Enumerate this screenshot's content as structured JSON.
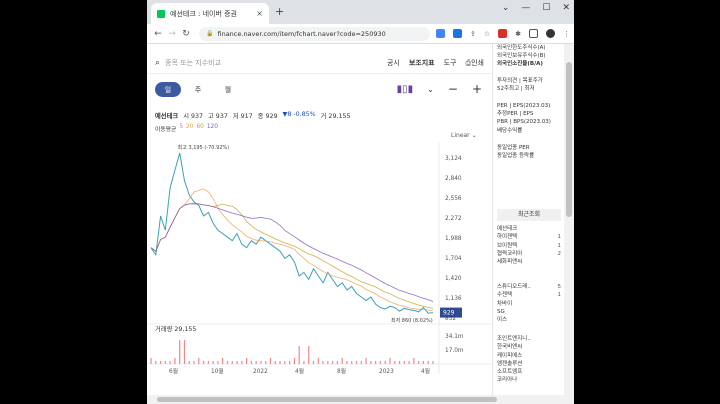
{
  "browser": {
    "tab_title": "예선테크 : 네이버 증권",
    "tab_close": "×",
    "new_tab": "+",
    "window_controls": [
      "⌄",
      "—",
      "☐",
      "✕"
    ],
    "url": "finance.naver.com/item/fchart.naver?code=250930"
  },
  "search": {
    "placeholder": "종목 또는 지수비교"
  },
  "toplinks": [
    "공시",
    "보조지표",
    "도구",
    "인쇄"
  ],
  "periods": [
    "일",
    "주",
    "월"
  ],
  "active_period": 0,
  "quote": {
    "name": "예선테크",
    "open": "시 937",
    "high": "고 937",
    "low": "저 917",
    "close": "종 929",
    "change": "▼8 -0.85%",
    "volume": "거 29,155"
  },
  "ma": {
    "label": "이동평균",
    "items": [
      {
        "v": "5",
        "color": "#e57373"
      },
      {
        "v": "20",
        "color": "#f0a04b"
      },
      {
        "v": "60",
        "color": "#c9a227"
      },
      {
        "v": "120",
        "color": "#7e57c2"
      }
    ]
  },
  "scale": "Linear",
  "volume_label": "거래량 29,155",
  "chart_data": {
    "type": "line",
    "y_ticks": [
      "3,124",
      "2,840",
      "2,556",
      "2,272",
      "1,988",
      "1,704",
      "1,420",
      "1,136",
      "852"
    ],
    "ylim": [
      852,
      3124
    ],
    "x_ticks": [
      "6월",
      "10월",
      "2022",
      "4월",
      "8월",
      "2023",
      "4월"
    ],
    "last_price": "929",
    "high_label": "최고 3,195 (-70.92%)",
    "low_label": "최저 860 (8.02%)",
    "volume_ticks": [
      "34.1m",
      "17.0m"
    ],
    "series": [
      {
        "values": [
          1850,
          1750,
          2300,
          2100,
          2700,
          2950,
          3195,
          2800,
          2600,
          2500,
          2450,
          2300,
          2350,
          2200,
          2100,
          2050,
          2000,
          1950,
          2050,
          1900,
          1850,
          1950,
          1900,
          2000,
          1950,
          1900,
          1850,
          1800,
          1700,
          1750,
          1650,
          1450,
          1500,
          1400,
          1550,
          1450,
          1350,
          1500,
          1400,
          1300,
          1350,
          1250,
          1300,
          1200,
          1150,
          1100,
          1150,
          1050,
          1000,
          980,
          1020,
          1000,
          950,
          990,
          970,
          960,
          940,
          1000,
          920,
          929
        ]
      }
    ]
  },
  "sidepanel": {
    "top_items": [
      "외국인한도주식수(A)",
      "외국인보유주식수(B)",
      "외국인소진율(B/A)"
    ],
    "invest_items": [
      "투자의견 | 목표주가",
      "52주최고 | 최저"
    ],
    "per_items": [
      "PER | EPS(2023.03)",
      "추정PER | EPS",
      "PBR | BPS(2023.03)",
      "배당수익률"
    ],
    "industry_items": [
      "동일업종 PER",
      "동일업종 등락률"
    ],
    "recent_title": "최근조회",
    "recent": [
      {
        "name": "예선테크",
        "count": ""
      },
      {
        "name": "하이젠텍",
        "count": "1"
      },
      {
        "name": "브이원텍",
        "count": "1"
      },
      {
        "name": "협력코리아",
        "count": "2"
      },
      {
        "name": "세화피앤씨",
        "count": ""
      }
    ],
    "recent2": [
      {
        "name": "스튜디오드래..",
        "count": "5"
      },
      {
        "name": "수젠텍",
        "count": "1"
      },
      {
        "name": "차바이",
        "count": ""
      },
      {
        "name": "SG",
        "count": ""
      },
      {
        "name": "이스",
        "count": ""
      }
    ],
    "recent3": [
      "조인트엔지니..",
      "한국비엔씨",
      "케이피에스",
      "엠젠솔루션",
      "소프트엠프",
      "코리아나"
    ]
  }
}
